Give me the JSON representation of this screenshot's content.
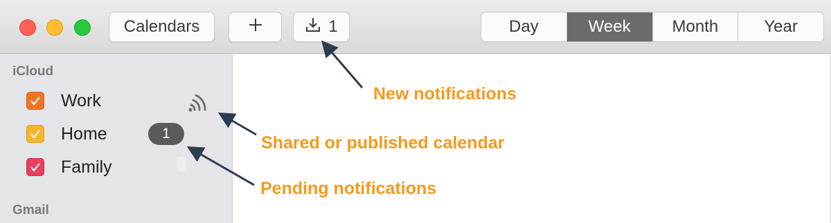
{
  "toolbar": {
    "calendars_label": "Calendars",
    "add_label": "+",
    "inbox_count": "1",
    "views": [
      "Day",
      "Week",
      "Month",
      "Year"
    ],
    "active_view": "Week"
  },
  "sidebar": {
    "groups": [
      {
        "label": "iCloud"
      },
      {
        "label": "Gmail"
      }
    ],
    "calendars": [
      {
        "name": "Work",
        "color": "#f07424",
        "checked": true,
        "shared": true
      },
      {
        "name": "Home",
        "color": "#f8b52b",
        "checked": true,
        "pending": "1"
      },
      {
        "name": "Family",
        "color": "#ea3f5d",
        "checked": true
      }
    ]
  },
  "annotations": {
    "new_notifications": "New notifications",
    "shared_calendar": "Shared or published calendar",
    "pending_notifications": "Pending notifications"
  },
  "colors": {
    "annotation": "#f39a1d",
    "arrow": "#2f3b4f",
    "active_segment": "#6b6b6b"
  }
}
